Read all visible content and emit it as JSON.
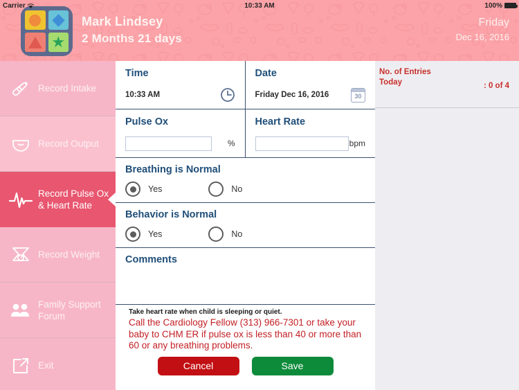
{
  "statusbar": {
    "carrier": "Carrier",
    "wifi_icon": "wifi-icon",
    "time": "10:33 AM",
    "battery_percent": "100%",
    "battery_icon": "battery-full-icon"
  },
  "header": {
    "logo_icon": "app-logo-shapes-icon",
    "patient_name": "Mark Lindsey",
    "patient_age": "2 Months 21 days",
    "day": "Friday",
    "date": "Dec 16, 2016",
    "background_color": "#fba3a8"
  },
  "sidebar": {
    "items": [
      {
        "label": "Record Intake",
        "icon": "baby-bottle-icon",
        "active": false
      },
      {
        "label": "Record Output",
        "icon": "diaper-icon",
        "active": false
      },
      {
        "label": "Record Pulse Ox\n& Heart Rate",
        "line1": "Record Pulse Ox",
        "line2": "& Heart Rate",
        "icon": "heartbeat-pulse-icon",
        "active": true
      },
      {
        "label": "Record Weight",
        "icon": "weight-scale-icon",
        "active": false
      },
      {
        "label": "Family Support\nForum",
        "line1": "Family Support",
        "line2": "Forum",
        "icon": "people-group-icon",
        "active": false
      },
      {
        "label": "Exit",
        "icon": "exit-arrow-icon",
        "active": false
      }
    ],
    "active_color": "#e8566f",
    "base_color": "#f7b6c7"
  },
  "form": {
    "time": {
      "label": "Time",
      "value": "10:33 AM",
      "picker_icon": "clock-icon"
    },
    "date": {
      "label": "Date",
      "value": "Friday Dec 16, 2016",
      "picker_icon": "calendar-icon",
      "calendar_day": "30"
    },
    "pulse_ox": {
      "label": "Pulse Ox",
      "value": "",
      "placeholder": "",
      "unit": "%"
    },
    "heart_rate": {
      "label": "Heart Rate",
      "value": "",
      "placeholder": "",
      "unit": "bpm"
    },
    "breathing": {
      "label": "Breathing is Normal",
      "yes_label": "Yes",
      "no_label": "No",
      "selected": "Yes"
    },
    "behavior": {
      "label": "Behavior is Normal",
      "yes_label": "Yes",
      "no_label": "No",
      "selected": "Yes"
    },
    "comments": {
      "label": "Comments",
      "value": "",
      "placeholder": ""
    },
    "note": "Take heart rate when child is sleeping or quiet.",
    "warning": "Call the Cardiology Fellow (313) 966-7301 or take your baby to CHM ER if pulse ox is less than 40 or more than 60 or any breathing problems.",
    "warning_color": "#c32025",
    "cancel_label": "Cancel",
    "save_label": "Save",
    "cancel_color": "#c20f13",
    "save_color": "#0d8b3a"
  },
  "right_panel": {
    "title_line1": "No. of Entries",
    "title_line2": "Today",
    "count": ": 0 of 4",
    "text_color": "#c8302c",
    "background_color": "#eeeef2"
  }
}
